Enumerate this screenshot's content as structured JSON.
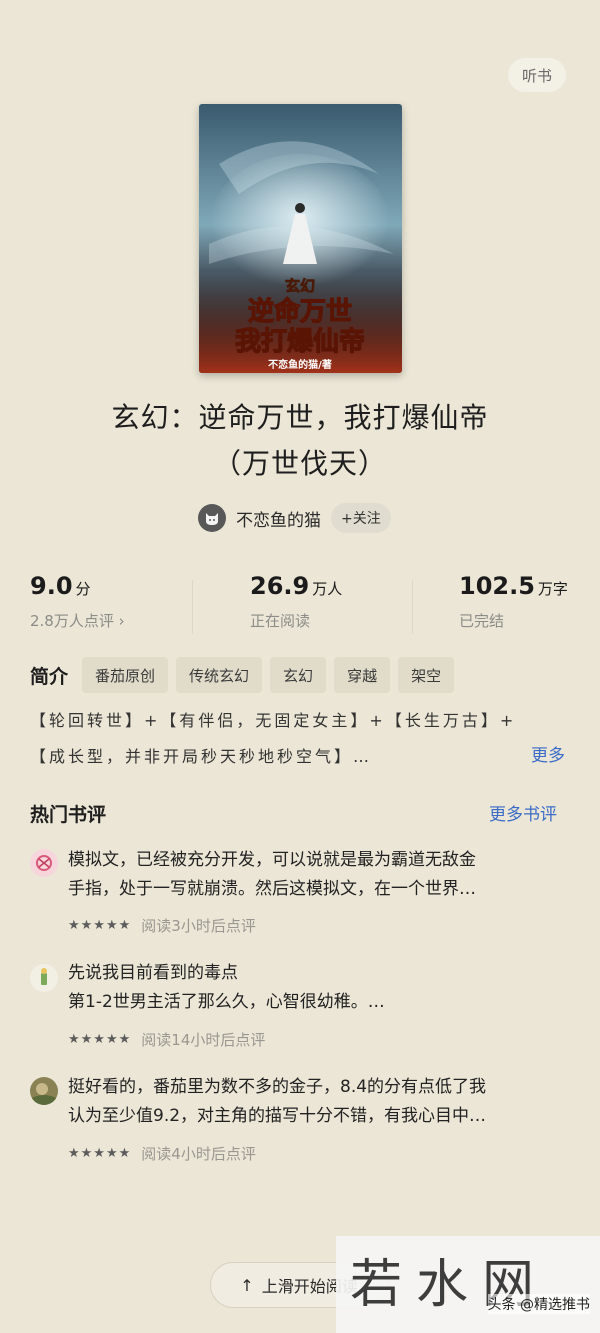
{
  "header": {
    "listen_label": "听书"
  },
  "book": {
    "cover_text": {
      "genre": "玄幻",
      "line1": "逆命万世",
      "line2": "我打爆仙帝",
      "byline": "不恋鱼的猫/著"
    },
    "title_line1": "玄幻：逆命万世，我打爆仙帝",
    "title_line2": "（万世伐天）"
  },
  "author": {
    "name": "不恋鱼的猫",
    "follow_label": "+关注",
    "avatar_icon": "cat-icon"
  },
  "stats": [
    {
      "value": "9.0",
      "unit": "分",
      "sub": "2.8万人点评 ›"
    },
    {
      "value": "26.9",
      "unit": "万人",
      "sub": "正在阅读"
    },
    {
      "value": "102.5",
      "unit": "万字",
      "sub": "已完结"
    }
  ],
  "intro": {
    "label": "简介",
    "tags": [
      "番茄原创",
      "传统玄幻",
      "玄幻",
      "穿越",
      "架空"
    ],
    "line1": "【轮回转世】+【有伴侣，无固定女主】+【长生万古】+",
    "line2": "【成长型，并非开局秒天秒地秒空气】…",
    "more_label": "更多"
  },
  "reviews_section": {
    "title": "热门书评",
    "more_label": "更多书评",
    "reviews": [
      {
        "line1": "模拟文，已经被充分开发，可以说就是最为霸道无敌金",
        "line2": "手指，处于一写就崩溃。然后这模拟文，在一个世界…",
        "stars": "★★★★★",
        "meta": "阅读3小时后点评"
      },
      {
        "line1": "先说我目前看到的毒点",
        "line2": "第1-2世男主活了那么久，心智很幼稚。…",
        "stars": "★★★★★",
        "meta": "阅读14小时后点评"
      },
      {
        "line1": "挺好看的，番茄里为数不多的金子，8.4的分有点低了我",
        "line2": "认为至少值9.2，对主角的描写十分不错，有我心目中…",
        "stars": "★★★★★",
        "meta": "阅读4小时后点评"
      }
    ]
  },
  "footer": {
    "slide_label": "上滑开始阅读"
  },
  "watermark": {
    "big": "若水网",
    "small": "头条 @精选推书"
  }
}
